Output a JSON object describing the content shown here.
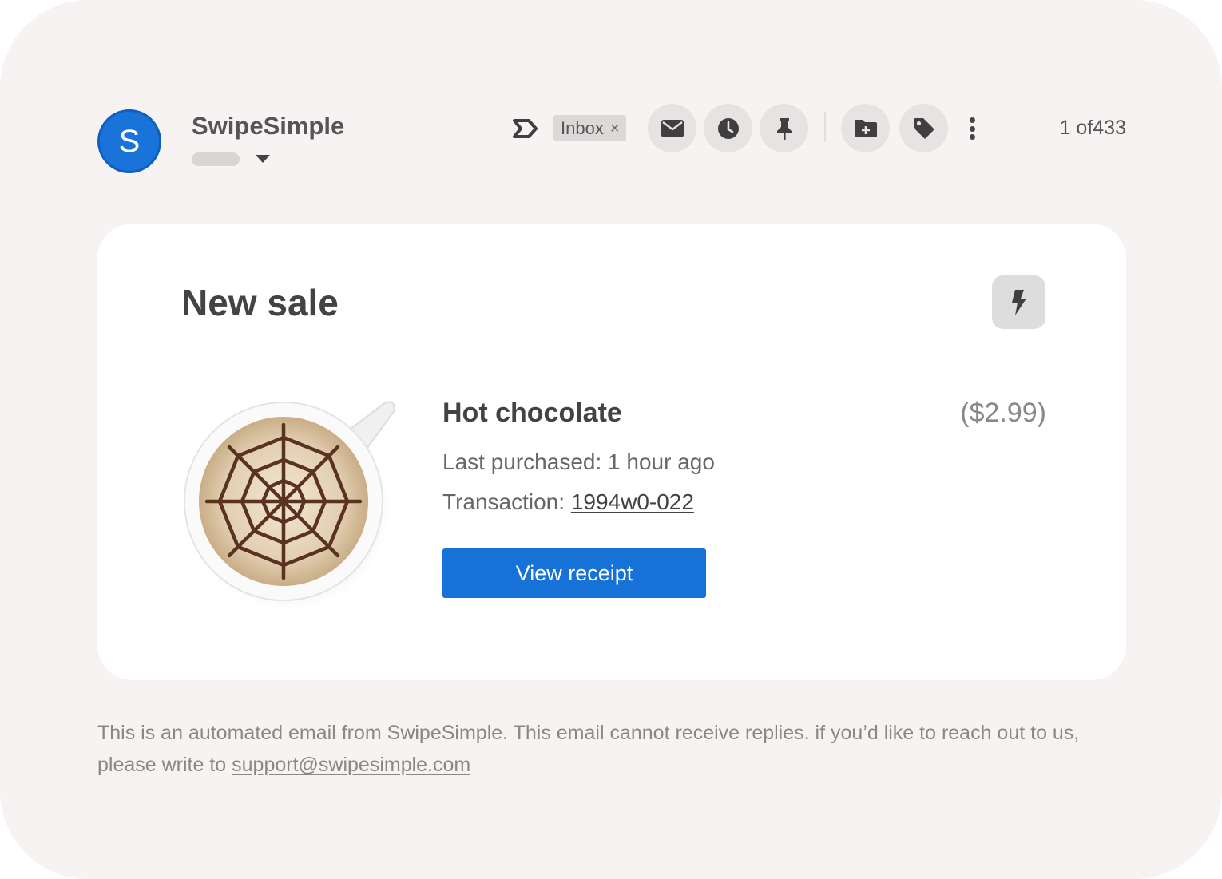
{
  "sender": {
    "avatar_letter": "S",
    "name": "SwipeSimple"
  },
  "toolbar": {
    "inbox_chip": "Inbox",
    "inbox_chip_close": "×",
    "buttons": [
      "mail-icon",
      "snooze-clock-icon",
      "pin-icon",
      "move-to-folder-icon",
      "tag-icon",
      "more-vertical-icon"
    ],
    "message_count": "1 of433"
  },
  "card": {
    "title": "New sale",
    "action_icon": "lightning-bolt-icon",
    "product": {
      "name": "Hot chocolate",
      "price": "($2.99)",
      "last_purchased": "Last purchased: 1 hour ago",
      "transaction_label": "Transaction: ",
      "transaction_id": "1994w0-022",
      "button_label": "View receipt"
    }
  },
  "footer": {
    "text": "This is an automated email from SwipeSimple. This email cannot receive replies. if you’d like to reach out to us, please write to ",
    "email": "support@swipesimple.com"
  },
  "colors": {
    "accent": "#1672d6",
    "avatar": "#1a73d9",
    "background": "#f6f3f2"
  }
}
